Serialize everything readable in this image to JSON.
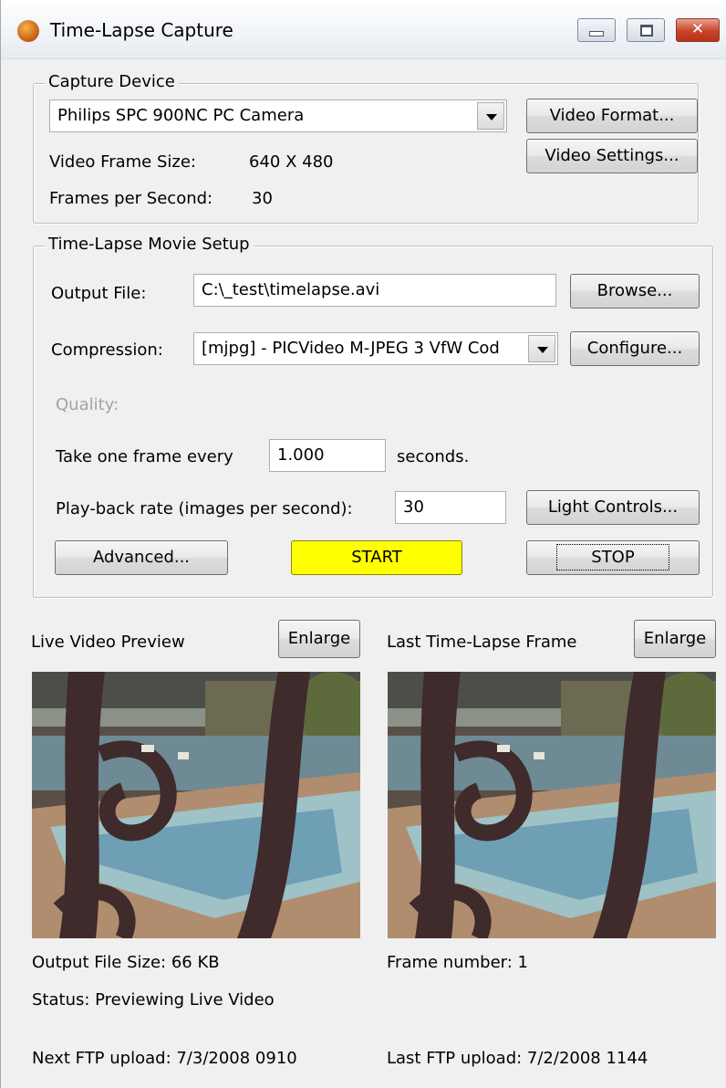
{
  "window": {
    "title": "Time-Lapse Capture"
  },
  "capture_device": {
    "legend": "Capture Device",
    "device_selected": "Philips SPC 900NC PC Camera",
    "video_format_button": "Video Format...",
    "video_settings_button": "Video Settings...",
    "frame_size_label": "Video Frame Size:",
    "frame_size_value": "640 X 480",
    "fps_label": "Frames per Second:",
    "fps_value": "30"
  },
  "movie_setup": {
    "legend": "Time-Lapse Movie Setup",
    "output_file_label": "Output File:",
    "output_file_value": "C:\\_test\\timelapse.avi",
    "browse_button": "Browse...",
    "compression_label": "Compression:",
    "compression_selected": "[mjpg] - PICVideo M-JPEG 3 VfW Cod",
    "configure_button": "Configure...",
    "quality_label": "Quality:",
    "interval_label": "Take one frame every",
    "interval_value": "1.000",
    "interval_unit": "seconds.",
    "playback_label": "Play-back rate (images per second):",
    "playback_value": "30",
    "light_controls_button": "Light Controls...",
    "advanced_button": "Advanced...",
    "start_button": "START",
    "stop_button": "STOP"
  },
  "preview": {
    "live_title": "Live Video Preview",
    "live_enlarge_button": "Enlarge",
    "last_title": "Last Time-Lapse Frame",
    "last_enlarge_button": "Enlarge",
    "output_file_size": "Output File Size:  66 KB",
    "frame_number": "Frame number:  1",
    "status": "Status:  Previewing Live Video",
    "next_ftp": "Next FTP upload:  7/3/2008 0910",
    "last_ftp": "Last FTP upload:  7/2/2008 1144"
  },
  "colors": {
    "start_button_bg": "#ffff00",
    "window_bg": "#f0f0f0"
  },
  "icons": {
    "app_icon": "camera-orb-icon"
  }
}
